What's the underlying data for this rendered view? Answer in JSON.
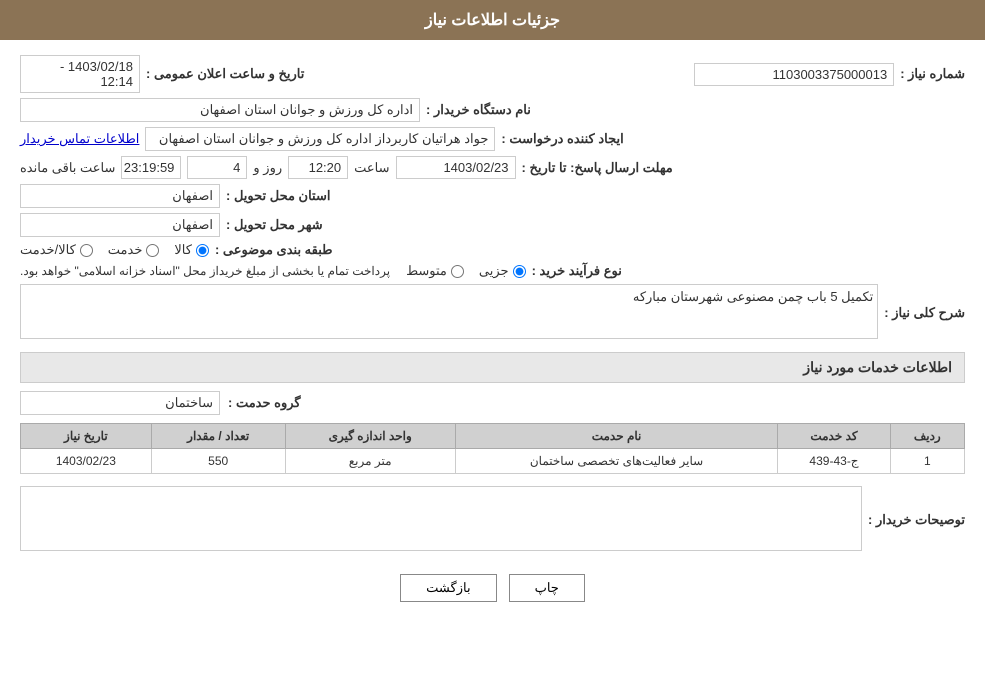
{
  "header": {
    "title": "جزئیات اطلاعات نیاز"
  },
  "fields": {
    "need_number_label": "شماره نیاز :",
    "need_number_value": "1103003375000013",
    "buyer_org_label": "نام دستگاه خریدار :",
    "buyer_org_value": "اداره کل ورزش و جوانان استان اصفهان",
    "requester_label": "ایجاد کننده درخواست :",
    "requester_value": "جواد هراتیان کاربرداز اداره کل ورزش و جوانان استان اصفهان",
    "contact_link": "اطلاعات تماس خریدار",
    "announce_date_label": "تاریخ و ساعت اعلان عمومی :",
    "announce_date_value": "1403/02/18 - 12:14",
    "deadline_label": "مهلت ارسال پاسخ: تا تاریخ :",
    "deadline_date": "1403/02/23",
    "deadline_time_label": "ساعت",
    "deadline_time_value": "12:20",
    "deadline_days_label": "روز و",
    "deadline_days_value": "4",
    "deadline_remaining_label": "ساعت باقی مانده",
    "deadline_remaining_value": "23:19:59",
    "province_label": "استان محل تحویل :",
    "province_value": "اصفهان",
    "city_label": "شهر محل تحویل :",
    "city_value": "اصفهان",
    "category_label": "طبقه بندی موضوعی :",
    "category_radio1": "کالا",
    "category_radio2": "خدمت",
    "category_radio3": "کالا/خدمت",
    "process_label": "نوع فرآیند خرید :",
    "process_radio1": "جزیی",
    "process_radio2": "متوسط",
    "process_note": "پرداخت تمام یا بخشی از مبلغ خریداز محل \"اسناد خزانه اسلامی\" خواهد بود.",
    "description_label": "شرح کلی نیاز :",
    "description_value": "تکمیل 5 باب چمن مصنوعی شهرستان مبارکه",
    "services_section_label": "اطلاعات خدمات مورد نیاز",
    "service_group_label": "گروه حدمت :",
    "service_group_value": "ساختمان",
    "buyer_notes_label": "توصیحات خریدار :",
    "table": {
      "headers": [
        "ردیف",
        "کد خدمت",
        "نام حدمت",
        "واحد اندازه گیری",
        "تعداد / مقدار",
        "تاریخ نیاز"
      ],
      "rows": [
        {
          "row": "1",
          "code": "ج-43-439",
          "name": "سایر فعالیت‌های تخصصی ساختمان",
          "unit": "متر مربع",
          "quantity": "550",
          "date": "1403/02/23"
        }
      ]
    },
    "back_button": "بازگشت",
    "print_button": "چاپ"
  }
}
